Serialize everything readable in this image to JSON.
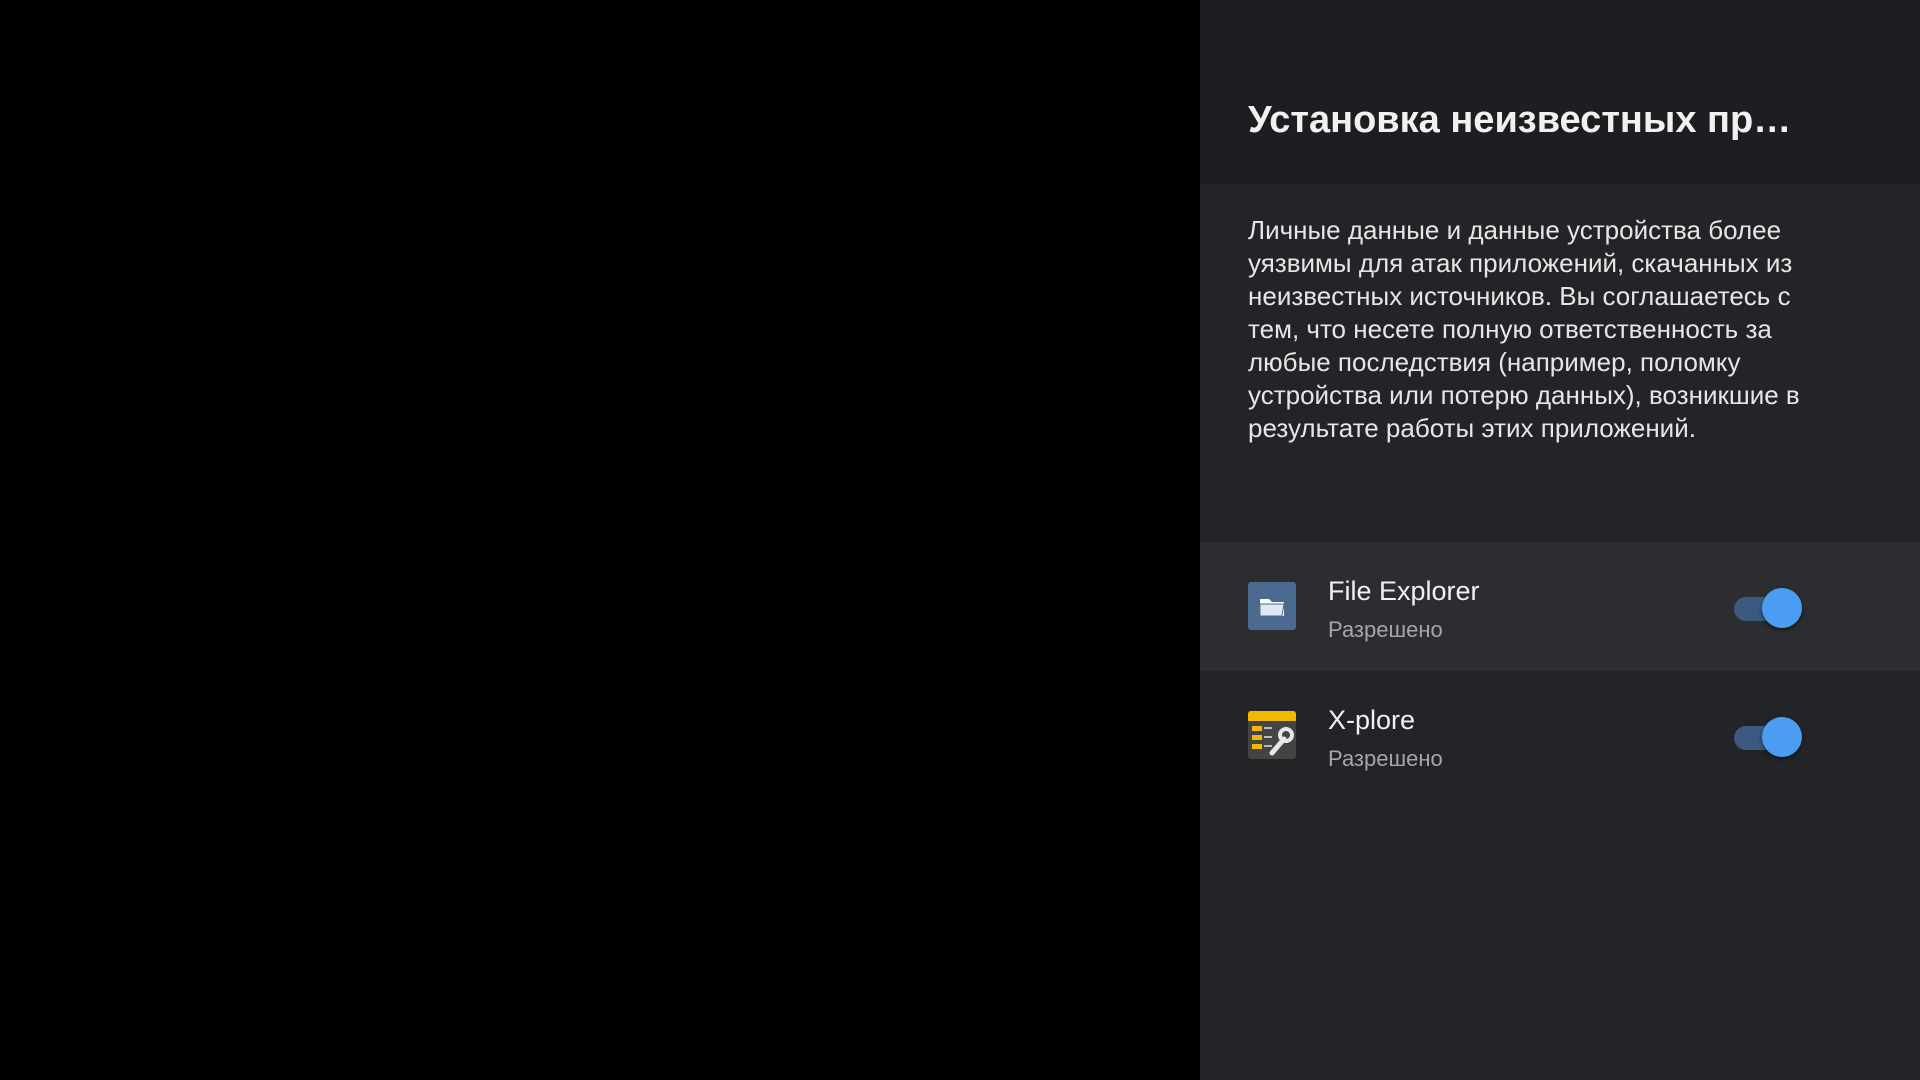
{
  "panel": {
    "title": "Установка неизвестных пр…",
    "description": "Личные данные и данные устройства более уязвимы для атак приложений, скачанных из неизвестных источников. Вы соглашаетесь с тем, что несете полную ответственность за любые последствия (например, поломку устройства или потерю данных), возникшие в результате работы этих приложений."
  },
  "apps": [
    {
      "name": "File Explorer",
      "status": "Разрешено",
      "enabled": true,
      "focused": true,
      "icon": "folder-icon"
    },
    {
      "name": "X-plore",
      "status": "Разрешено",
      "enabled": true,
      "focused": false,
      "icon": "xplore-app-icon"
    }
  ],
  "colors": {
    "background": "#000000",
    "panel": "#232427",
    "header": "#1d1e21",
    "focused_row": "#2c2d31",
    "toggle_thumb": "#4a9df0",
    "toggle_track": "#3c5a80"
  }
}
